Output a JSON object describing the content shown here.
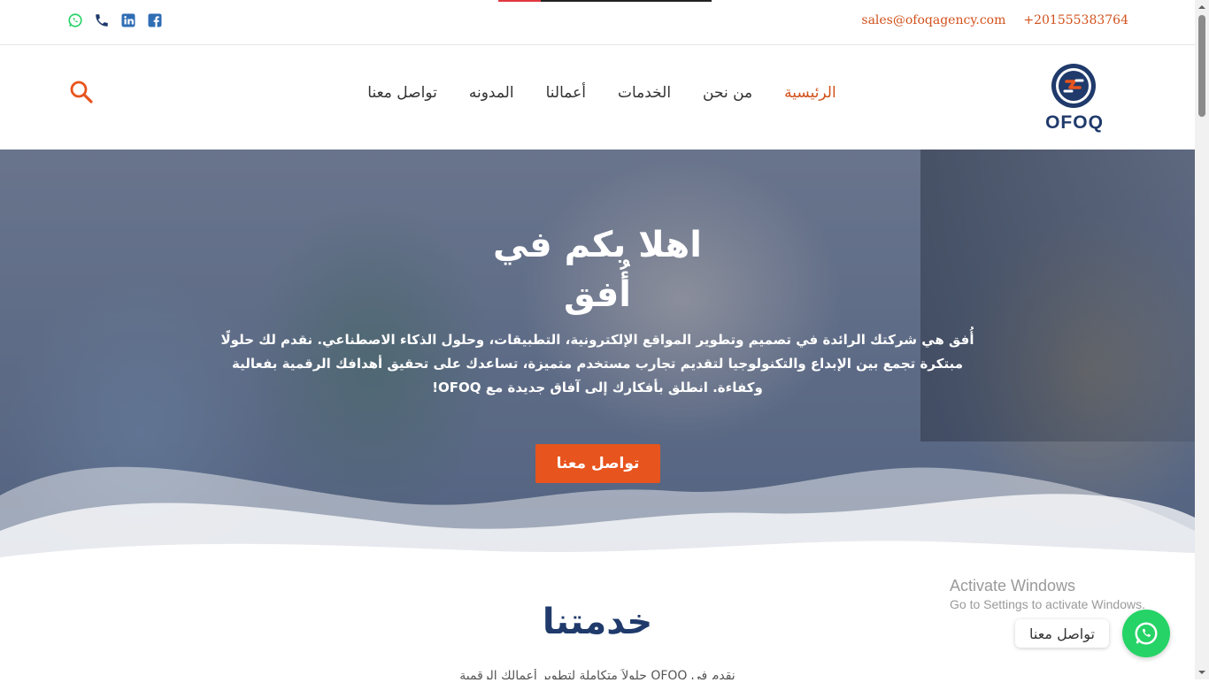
{
  "topbar": {
    "email": "sales@ofoqagency.com",
    "phone": "+201555383764",
    "social_icons": [
      "whatsapp-icon",
      "phone-icon",
      "linkedin-icon",
      "facebook-icon"
    ],
    "reading_progress": 0.2
  },
  "header": {
    "logo_text": "OFOQ",
    "nav": [
      {
        "label": "الرئيسية",
        "active": true
      },
      {
        "label": "من نحن",
        "active": false
      },
      {
        "label": "الخدمات",
        "active": false
      },
      {
        "label": "أعمالنا",
        "active": false
      },
      {
        "label": "المدونه",
        "active": false
      },
      {
        "label": "تواصل معنا",
        "active": false
      }
    ],
    "search_icon": "search-icon"
  },
  "hero": {
    "title": "اهلا بكم في أُفق",
    "text": "أُفق هي شركتك الرائدة في تصميم وتطوير المواقع الإلكترونية، التطبيقات، وحلول الذكاء الاصطناعي. نقدم لك حلولًا مبتكرة تجمع بين الإبداع والتكنولوجيا لتقديم تجارب مستخدم متميزة، تساعدك على تحقيق أهدافك الرقمية بفعالية وكفاءة. انطلق بأفكارك إلى آفاق جديدة مع OFOQ!",
    "cta_label": "تواصل معنا"
  },
  "services": {
    "title": "خدمتنا",
    "subtitle": "نقدم في OFOQ حلولاً متكاملة لتطوير أعمالك الرقمية"
  },
  "watermark": {
    "title": "Activate Windows",
    "subtitle": "Go to Settings to activate Windows."
  },
  "whatsapp_widget": {
    "label": "تواصل معنا",
    "icon": "whatsapp-icon"
  },
  "colors": {
    "accent": "#e8541e",
    "brand_navy": "#1f3a6b",
    "whatsapp": "#25d366"
  }
}
